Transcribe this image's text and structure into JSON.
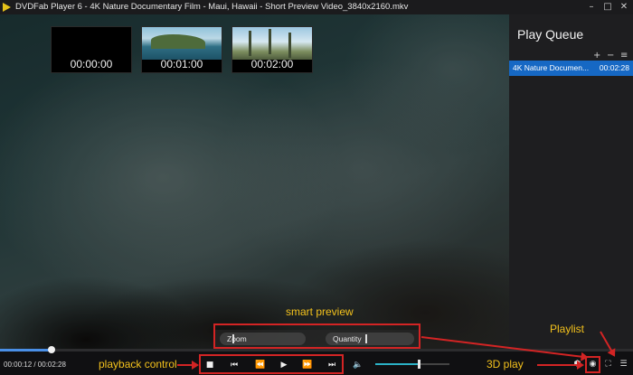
{
  "window": {
    "title": "DVDFab Player 6 - 4K Nature Documentary Film - Maui, Hawaii - Short Preview Video_3840x2160.mkv",
    "minimize_icon": "minimize-icon",
    "maximize_icon": "maximize-icon",
    "close_icon": "close-icon"
  },
  "thumbnails": [
    {
      "time": "00:00:00"
    },
    {
      "time": "00:01:00"
    },
    {
      "time": "00:02:00"
    }
  ],
  "smart_preview": {
    "zoom_label": "Zoom",
    "quantity_label": "Quantity",
    "zoom_level": 0.15,
    "quantity_level": 0.45
  },
  "sidebar": {
    "title": "Play Queue",
    "tools": [
      "+",
      "−",
      "≡"
    ],
    "queue": [
      {
        "name": "4K Nature Documen...",
        "duration": "00:02:28"
      }
    ]
  },
  "playback": {
    "current_time": "00:00:12",
    "duration": "00:02:28",
    "time_text": "00:00:12 / 00:02:28",
    "progress_fraction": 0.081,
    "volume_fraction": 0.57,
    "accent_color": "#4a8fe6",
    "volume_color": "#2bb2c6"
  },
  "annotations": {
    "smart_preview": "smart preview",
    "playlist": "Playlist",
    "playback_control": "playback control",
    "play_3d": "3D play",
    "color": "#f3c11c",
    "box_color": "#d32424"
  },
  "icons": {
    "stop": "■",
    "prev": "⏮",
    "rewind": "⏪",
    "play": "▶",
    "forward": "⏩",
    "next": "⏭",
    "volume": "🔈",
    "cube": "⬢",
    "eye3d": "◉",
    "fullscreen": "⛶",
    "playlist": "☰"
  }
}
